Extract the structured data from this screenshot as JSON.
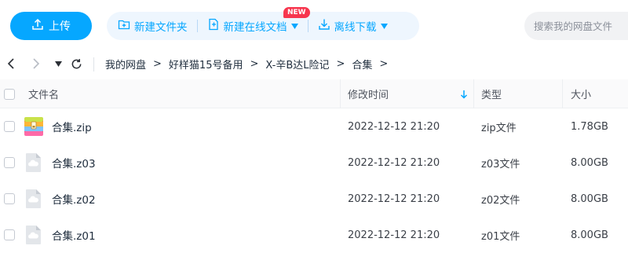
{
  "toolbar": {
    "upload_label": "上传",
    "new_folder_label": "新建文件夹",
    "new_online_doc_label": "新建在线文档",
    "new_badge": "NEW",
    "offline_download_label": "离线下载",
    "search_placeholder": "搜索我的网盘文件",
    "accent_color": "#06a7ff"
  },
  "breadcrumb": {
    "items": [
      "我的网盘",
      "好样猫15号备用",
      "X-辛B达L险记",
      "合集"
    ],
    "separator": ">"
  },
  "table": {
    "headers": {
      "name": "文件名",
      "modified": "修改时间",
      "type": "类型",
      "size": "大小"
    },
    "sort_icon": "arrow-down-icon",
    "rows": [
      {
        "name": "合集.zip",
        "modified": "2022-12-12 21:20",
        "type": "zip文件",
        "size": "1.78GB",
        "icon": "zip-archive-icon"
      },
      {
        "name": "合集.z03",
        "modified": "2022-12-12 21:20",
        "type": "z03文件",
        "size": "8.00GB",
        "icon": "generic-file-icon"
      },
      {
        "name": "合集.z02",
        "modified": "2022-12-12 21:20",
        "type": "z02文件",
        "size": "8.00GB",
        "icon": "generic-file-icon"
      },
      {
        "name": "合集.z01",
        "modified": "2022-12-12 21:20",
        "type": "z01文件",
        "size": "8.00GB",
        "icon": "generic-file-icon"
      }
    ]
  }
}
